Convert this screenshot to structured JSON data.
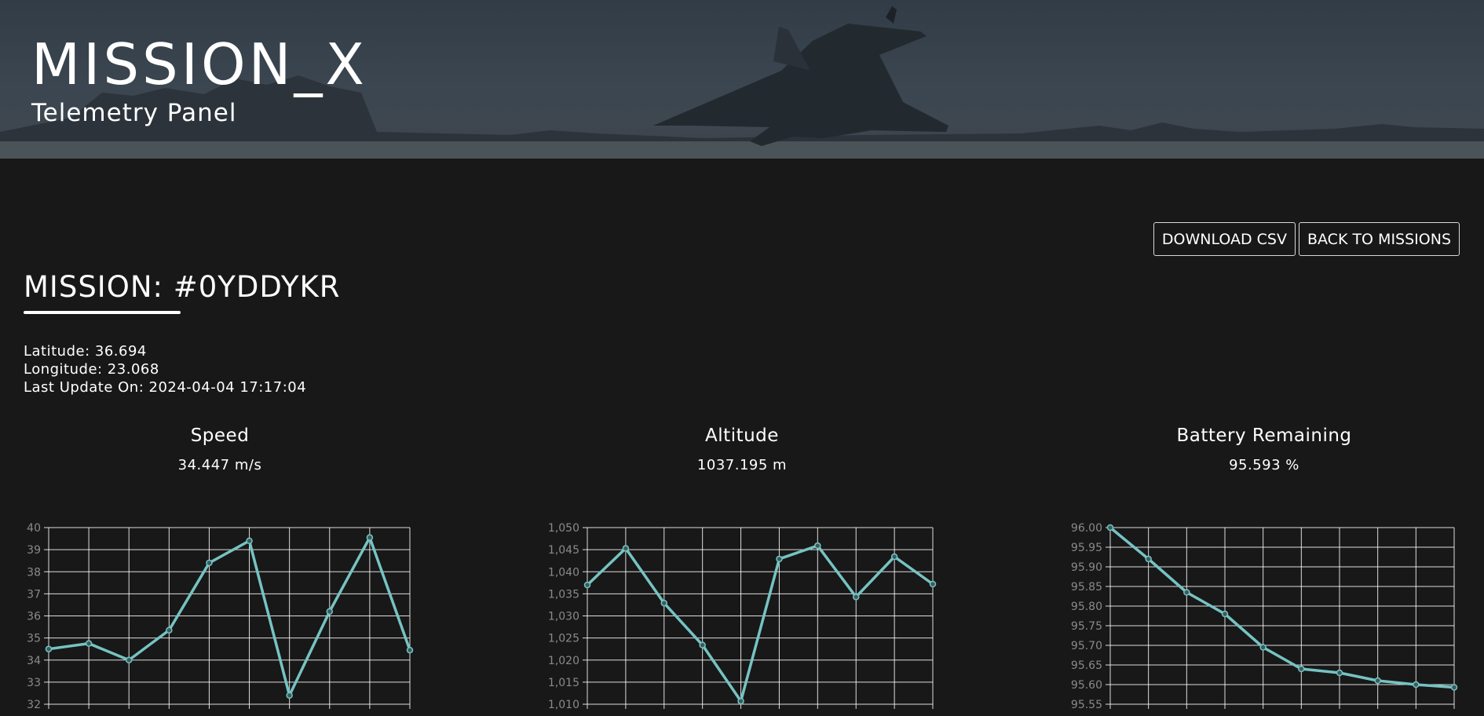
{
  "header": {
    "title": "MISSION_X",
    "subtitle": "Telemetry Panel"
  },
  "toolbar": {
    "download_label": "DOWNLOAD CSV",
    "back_label": "BACK TO MISSIONS"
  },
  "mission": {
    "label": "MISSION: ",
    "id": "#0YDDYKR",
    "latitude": "Latitude: 36.694",
    "longitude": "Longitude: 23.068",
    "last_update": "Last Update On: 2024-04-04 17:17:04"
  },
  "colors": {
    "background": "#181818",
    "line": "#76c3c3",
    "grid": "#ffffff",
    "tick_label": "#8a8a8a"
  },
  "charts": [
    {
      "title": "Speed",
      "value": "34.447 m/s"
    },
    {
      "title": "Altitude",
      "value": "1037.195 m"
    },
    {
      "title": "Battery Remaining",
      "value": "95.593 %"
    }
  ],
  "chart_data": [
    {
      "type": "line",
      "x": [
        0,
        1,
        2,
        3,
        4,
        5,
        6,
        7,
        8,
        9
      ],
      "values": [
        34.5,
        34.75,
        34.0,
        35.35,
        38.4,
        39.4,
        32.4,
        36.2,
        39.55,
        34.45
      ],
      "ylim": [
        32,
        40
      ],
      "yticks": [
        32,
        33,
        34,
        35,
        36,
        37,
        38,
        39,
        40
      ],
      "ytick_labels": [
        "32",
        "33",
        "34",
        "35",
        "36",
        "37",
        "38",
        "39",
        "40"
      ],
      "grid": true
    },
    {
      "type": "line",
      "x": [
        0,
        1,
        2,
        3,
        4,
        5,
        6,
        7,
        8,
        9
      ],
      "values": [
        1037,
        1045.3,
        1032.9,
        1023.4,
        1010.7,
        1042.9,
        1045.9,
        1034.3,
        1043.4,
        1037.2
      ],
      "ylim": [
        1010,
        1050
      ],
      "yticks": [
        1010,
        1015,
        1020,
        1025,
        1030,
        1035,
        1040,
        1045,
        1050
      ],
      "ytick_labels": [
        "1,010",
        "1,015",
        "1,020",
        "1,025",
        "1,030",
        "1,035",
        "1,040",
        "1,045",
        "1,050"
      ],
      "grid": true
    },
    {
      "type": "line",
      "x": [
        0,
        1,
        2,
        3,
        4,
        5,
        6,
        7,
        8,
        9
      ],
      "values": [
        96.0,
        95.92,
        95.835,
        95.78,
        95.695,
        95.64,
        95.63,
        95.61,
        95.6,
        95.593
      ],
      "ylim": [
        95.55,
        96.0
      ],
      "yticks": [
        95.55,
        95.6,
        95.65,
        95.7,
        95.75,
        95.8,
        95.85,
        95.9,
        95.95,
        96.0
      ],
      "ytick_labels": [
        "95.55",
        "95.60",
        "95.65",
        "95.70",
        "95.75",
        "95.80",
        "95.85",
        "95.90",
        "95.95",
        "96.00"
      ],
      "grid": true
    }
  ]
}
